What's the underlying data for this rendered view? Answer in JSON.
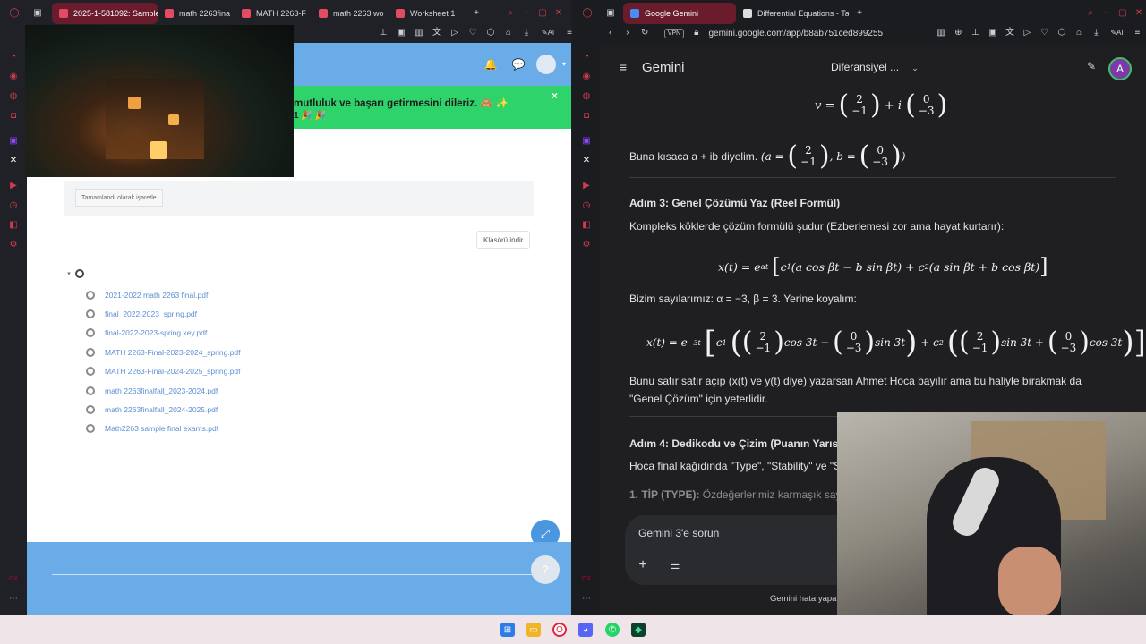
{
  "left": {
    "tabs": [
      {
        "label": "2025-1-581092: Sample F",
        "active": true
      },
      {
        "label": "math 2263fina"
      },
      {
        "label": "MATH 2263-F"
      },
      {
        "label": "math 2263 wo"
      },
      {
        "label": "Worksheet 1"
      }
    ],
    "banner": {
      "text": "mutluluk ve başarı getirmesini dileriz. 🙈 ✨",
      "text2": "1 🎉 🎉"
    },
    "mark_done_label": "Tamamlandı olarak işaretle",
    "download_folder_label": "Klasörü indir",
    "files": [
      "2021-2022 math 2263 final.pdf",
      "final_2022-2023_spring.pdf",
      "final-2022-2023-spring key.pdf",
      "MATH 2263-Final-2023-2024_spring.pdf",
      "MATH 2263-Final-2024-2025_spring.pdf",
      "math 2263finalfall_2023-2024.pdf",
      "math 2263finalfall_2024-2025.pdf",
      "Math2263 sample final exams.pdf"
    ],
    "close_glyph": "×"
  },
  "right": {
    "tabs": [
      {
        "label": "Google Gemini",
        "active": true
      },
      {
        "label": "Differential Equations - Tal"
      }
    ],
    "url": "gemini.google.com/app/b8ab751ced899255",
    "vpn_label": "VPN",
    "app_title": "Gemini",
    "chat_title": "Diferansiyel ...",
    "avatar_letter": "A",
    "content": {
      "intro_line": "Buna kısaca a + ib diyelim.",
      "step3_title": "Adım 3: Genel Çözümü Yaz (Reel Formül)",
      "step3_desc": "Kompleks köklerde çözüm formülü şudur (Ezberlemesi zor ama hayat kurtarır):",
      "our_numbers": "Bizim sayılarımız: α = −3, β = 3. Yerine koyalım:",
      "explain": "Bunu satır satır açıp (x(t) ve y(t) diye) yazarsan Ahmet Hoca bayılır ama bu haliyle bırakmak da \"Genel Çözüm\" için yeterlidir.",
      "step4_title": "Adım 4: Dedikodu ve Çizim (Puanın Yarısı",
      "step4_desc": "Hoca final kağıdında \"Type\", \"Stability\" ve \"S",
      "type_line_bold": "1. TİP (TYPE):",
      "type_line_rest": " Özdeğerlerimiz karmaşık sayı"
    },
    "input_placeholder": "Gemini 3'e sorun",
    "footer_text": "Gemini hata yapab"
  },
  "taskbar": [
    "windows",
    "files",
    "opera",
    "discord",
    "whatsapp",
    "app"
  ]
}
